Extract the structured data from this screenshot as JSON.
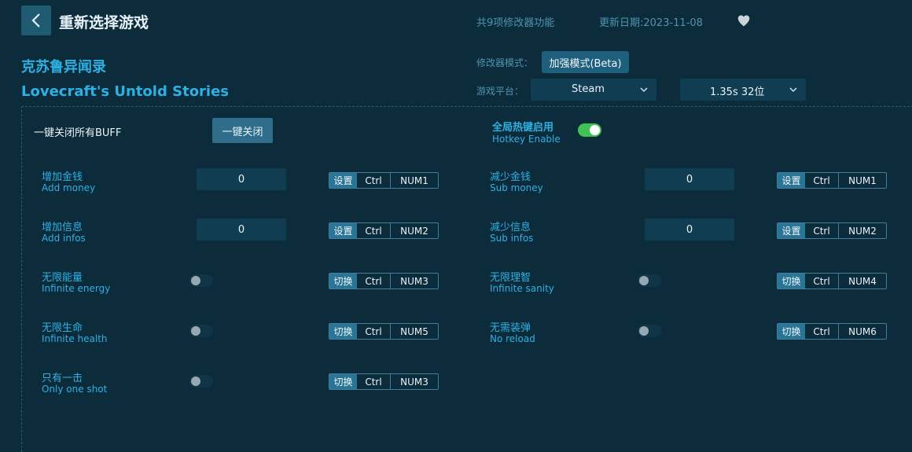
{
  "header": {
    "title": "重新选择游戏",
    "feature_count": "共9项修改器功能",
    "update_date": "更新日期:2023-11-08"
  },
  "game": {
    "name_cn": "克苏鲁异闻录",
    "name_en": "Lovecraft's Untold Stories"
  },
  "mode": {
    "label": "修改器模式：",
    "button": "加强模式(Beta)"
  },
  "platform": {
    "label": "游戏平台：",
    "selected": "Steam",
    "version": "1.35s 32位"
  },
  "close_all": {
    "label": "一键关闭所有BUFF",
    "button": "一键关闭"
  },
  "hotkey": {
    "label_cn": "全局热键启用",
    "label_en": "Hotkey Enable",
    "enabled": true
  },
  "items": [
    {
      "cn": "增加金钱",
      "en": "Add money",
      "type": "input",
      "value": "0",
      "action": "设置",
      "key1": "Ctrl",
      "key2": "NUM1"
    },
    {
      "cn": "减少金钱",
      "en": "Sub money",
      "type": "input",
      "value": "0",
      "action": "设置",
      "key1": "Ctrl",
      "key2": "NUM1"
    },
    {
      "cn": "增加信息",
      "en": "Add infos",
      "type": "input",
      "value": "0",
      "action": "设置",
      "key1": "Ctrl",
      "key2": "NUM2"
    },
    {
      "cn": "减少信息",
      "en": "Sub infos",
      "type": "input",
      "value": "0",
      "action": "设置",
      "key1": "Ctrl",
      "key2": "NUM2"
    },
    {
      "cn": "无限能量",
      "en": "Infinite energy",
      "type": "toggle",
      "on": false,
      "action": "切换",
      "key1": "Ctrl",
      "key2": "NUM3"
    },
    {
      "cn": "无限理智",
      "en": "Infinite sanity",
      "type": "toggle",
      "on": false,
      "action": "切换",
      "key1": "Ctrl",
      "key2": "NUM4"
    },
    {
      "cn": "无限生命",
      "en": "Infinite health",
      "type": "toggle",
      "on": false,
      "action": "切换",
      "key1": "Ctrl",
      "key2": "NUM5"
    },
    {
      "cn": "无需装弹",
      "en": "No reload",
      "type": "toggle",
      "on": false,
      "action": "切换",
      "key1": "Ctrl",
      "key2": "NUM6"
    },
    {
      "cn": "只有一击",
      "en": "Only one shot",
      "type": "toggle",
      "on": false,
      "action": "切换",
      "key1": "Ctrl",
      "key2": "NUM3"
    }
  ],
  "colors": {
    "background": "#0c2c3c",
    "accent": "#2fb0e3",
    "toggle_on": "#3fc253"
  }
}
